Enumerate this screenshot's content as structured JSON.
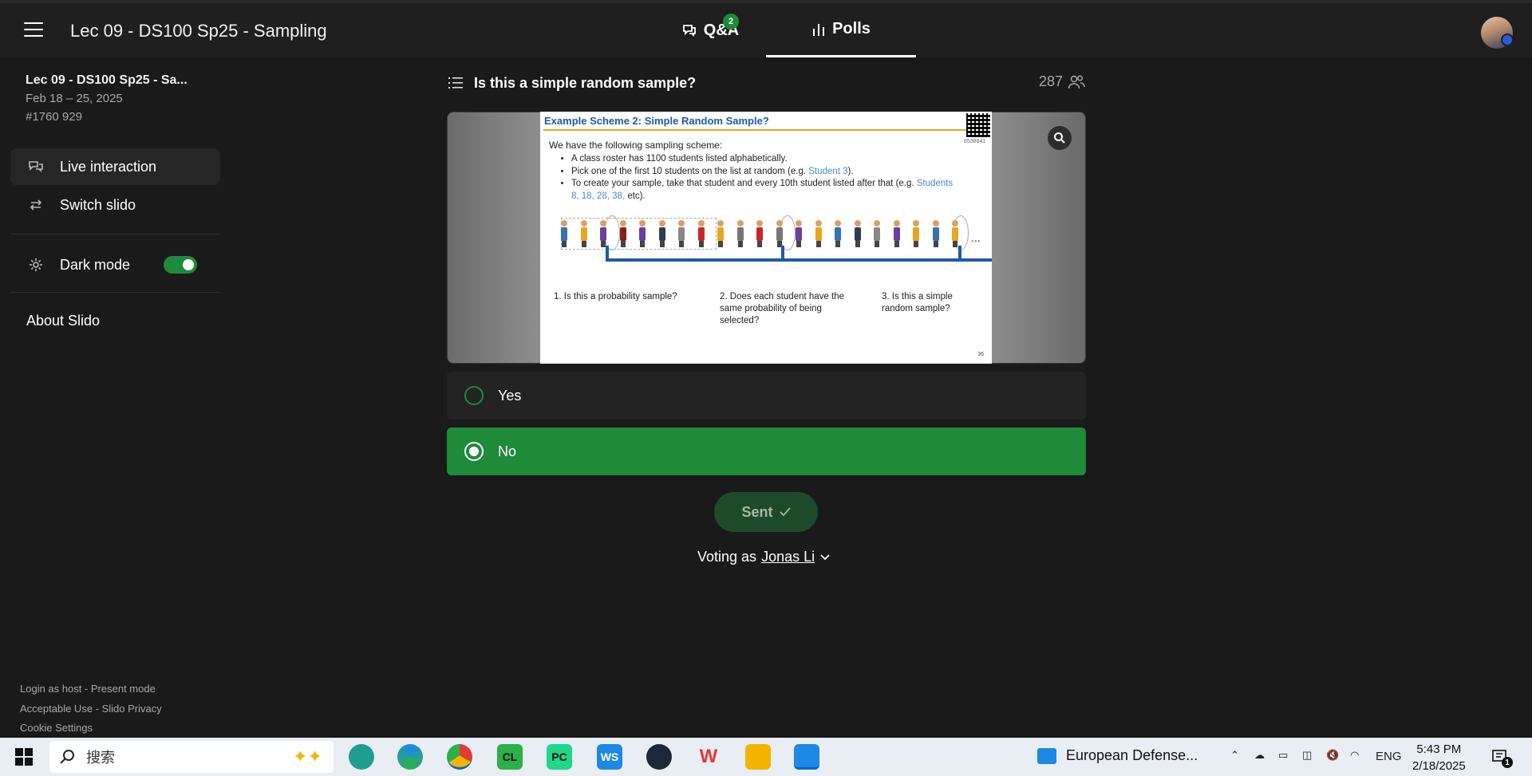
{
  "header": {
    "event_title": "Lec 09 - DS100 Sp25 - Sampling",
    "tabs": [
      {
        "label": "Q&A",
        "badge": "2"
      },
      {
        "label": "Polls"
      }
    ]
  },
  "sidebar": {
    "event_name": "Lec 09 - DS100 Sp25 - Sa...",
    "dates": "Feb 18 – 25, 2025",
    "code": "#1760 929",
    "items": [
      {
        "label": "Live interaction",
        "icon": "chat-bubbles-icon"
      },
      {
        "label": "Switch slido",
        "icon": "switch-arrows-icon"
      },
      {
        "label": "Dark mode",
        "icon": "gear-icon",
        "toggle_on": true
      }
    ],
    "about": "About Slido",
    "footer": [
      "Login as host - Present mode",
      "Acceptable Use - Slido Privacy",
      "Cookie Settings"
    ]
  },
  "poll": {
    "question": "Is this a simple random sample?",
    "participant_count": "287",
    "options": [
      {
        "label": "Yes",
        "selected": false
      },
      {
        "label": "No",
        "selected": true
      }
    ],
    "sent_label": "Sent",
    "voting_as_prefix": "Voting as",
    "voter_name": "Jonas Li"
  },
  "slide": {
    "title": "Example Scheme 2: Simple Random Sample?",
    "qr_code_number": "6538641",
    "intro": "We have the following sampling scheme:",
    "bullets": [
      {
        "pre": "A class roster has 1100 students listed alphabetically.",
        "hl": "",
        "post": ""
      },
      {
        "pre": "Pick one of the first 10 students on the list at random (e.g. ",
        "hl": "Student 3",
        "post": ")."
      },
      {
        "pre": "To create your sample, take that student and every 10th student listed after that (e.g. ",
        "hl": "Students 8, 18, 28, 38,",
        "post": " etc)."
      }
    ],
    "ellipsis": "...",
    "questions": [
      "1. Is this a probability sample?",
      "2. Does each student have the same probability of being selected?",
      "3. Is this a simple random sample?"
    ],
    "page_number": "36"
  },
  "taskbar": {
    "search_placeholder": "搜索",
    "apps": [
      {
        "label": "CL",
        "color": "#2bb04a"
      },
      {
        "label": "PC",
        "color": "#21d789"
      },
      {
        "label": "WS",
        "color": "#1e88e5"
      },
      {
        "label": "W",
        "color": "#e53935"
      }
    ],
    "news_text": "European Defense...",
    "language": "ENG",
    "time": "5:43 PM",
    "date": "2/18/2025",
    "notification_count": "1"
  },
  "colors": {
    "accent_green": "#1f8a3a",
    "background": "#1a1a1a",
    "header": "#1f1f1f",
    "slide_blue": "#1f5aa6"
  }
}
